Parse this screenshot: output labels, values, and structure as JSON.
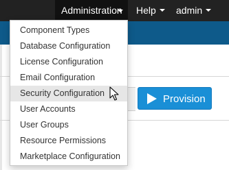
{
  "navbar": {
    "admin_label": "Administration",
    "help_label": "Help",
    "user_label": "admin"
  },
  "admin_menu": {
    "items": [
      {
        "label": "Component Types"
      },
      {
        "label": "Database Configuration"
      },
      {
        "label": "License Configuration"
      },
      {
        "label": "Email Configuration"
      },
      {
        "label": "Security Configuration",
        "highlighted": true
      },
      {
        "label": "User Accounts"
      },
      {
        "label": "User Groups"
      },
      {
        "label": "Resource Permissions"
      },
      {
        "label": "Marketplace Configuration"
      }
    ]
  },
  "toolbar": {
    "provision_label": "Provision"
  },
  "colors": {
    "navbar_bg": "#222222",
    "header_bg": "#0e5a8a",
    "provision_bg": "#1a8fd6",
    "menu_hover_bg": "#e6e6e6"
  },
  "icons": [
    "caret-down-icon",
    "play-icon",
    "mouse-pointer-icon"
  ]
}
